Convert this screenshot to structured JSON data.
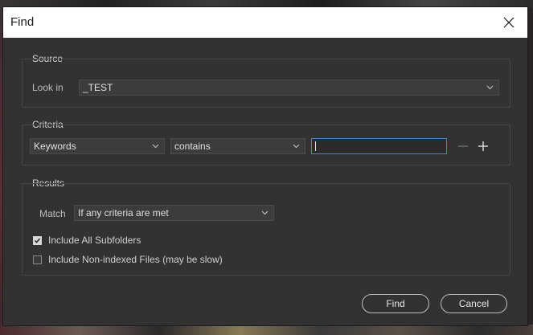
{
  "dialog": {
    "title": "Find",
    "close_icon": "close-icon"
  },
  "source": {
    "group_label": "Source",
    "look_in_label": "Look in",
    "look_in_value": "_TEST"
  },
  "criteria": {
    "group_label": "Criteria",
    "field_value": "Keywords",
    "operator_value": "contains",
    "text_value": "",
    "remove_icon": "minus-icon",
    "add_icon": "plus-icon"
  },
  "results": {
    "group_label": "Results",
    "match_label": "Match",
    "match_value": "If any criteria are met",
    "include_subfolders_label": "Include All Subfolders",
    "include_subfolders_checked": true,
    "include_nonindexed_label": "Include Non-indexed Files (may be slow)",
    "include_nonindexed_checked": false
  },
  "buttons": {
    "find_label": "Find",
    "cancel_label": "Cancel"
  },
  "colors": {
    "dialog_bg": "#323232",
    "titlebar_bg": "#ffffff",
    "focus_border": "#4c86c9"
  }
}
